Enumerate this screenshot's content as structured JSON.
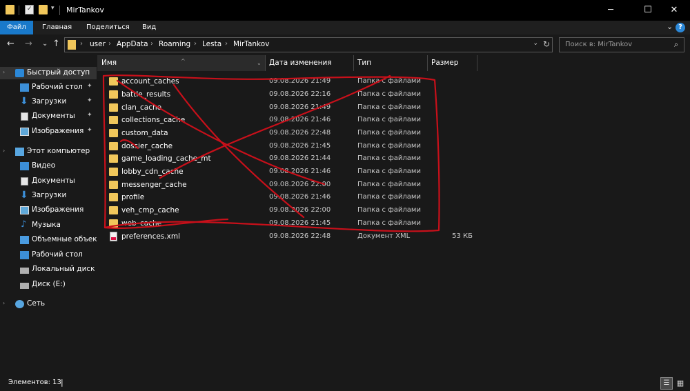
{
  "window": {
    "title": "MirTankov",
    "minimize": "─",
    "maximize": "☐",
    "close": "✕"
  },
  "ribbon": {
    "tabs": [
      "Файл",
      "Главная",
      "Поделиться",
      "Вид"
    ],
    "expand_glyph": "⌄",
    "help_glyph": "?"
  },
  "nav": {
    "back": "←",
    "forward": "→",
    "recent": "⌄",
    "up": "↑"
  },
  "address": {
    "crumbs": [
      "user",
      "AppData",
      "Roaming",
      "Lesta",
      "MirTankov"
    ],
    "separator": "›"
  },
  "search": {
    "placeholder": "Поиск в: MirTankov",
    "icon": "⌕"
  },
  "sidebar": {
    "items": [
      {
        "label": "Быстрый доступ",
        "icon": "star-icon",
        "pinned": false,
        "selected": true
      },
      {
        "label": "Рабочий стол",
        "icon": "desktop-icon",
        "pinned": true
      },
      {
        "label": "Загрузки",
        "icon": "downloads-icon",
        "pinned": true
      },
      {
        "label": "Документы",
        "icon": "documents-icon",
        "pinned": true
      },
      {
        "label": "Изображения",
        "icon": "pictures-icon",
        "pinned": true
      },
      {
        "label": "Этот компьютер",
        "icon": "computer-icon",
        "pinned": false
      },
      {
        "label": "Видео",
        "icon": "videos-icon",
        "pinned": false
      },
      {
        "label": "Документы",
        "icon": "documents-icon",
        "pinned": false
      },
      {
        "label": "Загрузки",
        "icon": "downloads-icon",
        "pinned": false
      },
      {
        "label": "Изображения",
        "icon": "pictures-icon",
        "pinned": false
      },
      {
        "label": "Музыка",
        "icon": "music-icon",
        "pinned": false
      },
      {
        "label": "Объемные объекты",
        "icon": "3d-objects-icon",
        "pinned": false
      },
      {
        "label": "Рабочий стол",
        "icon": "desktop-icon",
        "pinned": false
      },
      {
        "label": "Локальный диск (C",
        "icon": "drive-icon",
        "pinned": false
      },
      {
        "label": "Диск (E:)",
        "icon": "drive-icon",
        "pinned": false
      },
      {
        "label": "Сеть",
        "icon": "network-icon",
        "pinned": false
      }
    ],
    "pin_glyph": "📌"
  },
  "columns": {
    "name": "Имя",
    "date": "Дата изменения",
    "type": "Тип",
    "size": "Размер"
  },
  "files": [
    {
      "name": "account_caches",
      "date": "09.08.2026 21:49",
      "type": "Папка с файлами",
      "size": "",
      "kind": "folder"
    },
    {
      "name": "battle_results",
      "date": "09.08.2026 22:16",
      "type": "Папка с файлами",
      "size": "",
      "kind": "folder"
    },
    {
      "name": "clan_cache",
      "date": "09.08.2026 21:49",
      "type": "Папка с файлами",
      "size": "",
      "kind": "folder"
    },
    {
      "name": "collections_cache",
      "date": "09.08.2026 21:46",
      "type": "Папка с файлами",
      "size": "",
      "kind": "folder"
    },
    {
      "name": "custom_data",
      "date": "09.08.2026 22:48",
      "type": "Папка с файлами",
      "size": "",
      "kind": "folder"
    },
    {
      "name": "dossier_cache",
      "date": "09.08.2026 21:45",
      "type": "Папка с файлами",
      "size": "",
      "kind": "folder"
    },
    {
      "name": "game_loading_cache_mt",
      "date": "09.08.2026 21:44",
      "type": "Папка с файлами",
      "size": "",
      "kind": "folder"
    },
    {
      "name": "lobby_cdn_cache",
      "date": "09.08.2026 21:46",
      "type": "Папка с файлами",
      "size": "",
      "kind": "folder"
    },
    {
      "name": "messenger_cache",
      "date": "09.08.2026 22:00",
      "type": "Папка с файлами",
      "size": "",
      "kind": "folder"
    },
    {
      "name": "profile",
      "date": "09.08.2026 21:46",
      "type": "Папка с файлами",
      "size": "",
      "kind": "folder"
    },
    {
      "name": "veh_cmp_cache",
      "date": "09.08.2026 22:00",
      "type": "Папка с файлами",
      "size": "",
      "kind": "folder"
    },
    {
      "name": "web_cache",
      "date": "09.08.2026 21:45",
      "type": "Папка с файлами",
      "size": "",
      "kind": "folder"
    },
    {
      "name": "preferences.xml",
      "date": "09.08.2026 22:48",
      "type": "Документ XML",
      "size": "53 КБ",
      "kind": "xml"
    }
  ],
  "status": {
    "count": "Элементов: 13",
    "cursor": "|"
  },
  "annotation": {
    "color": "#c8101a"
  }
}
